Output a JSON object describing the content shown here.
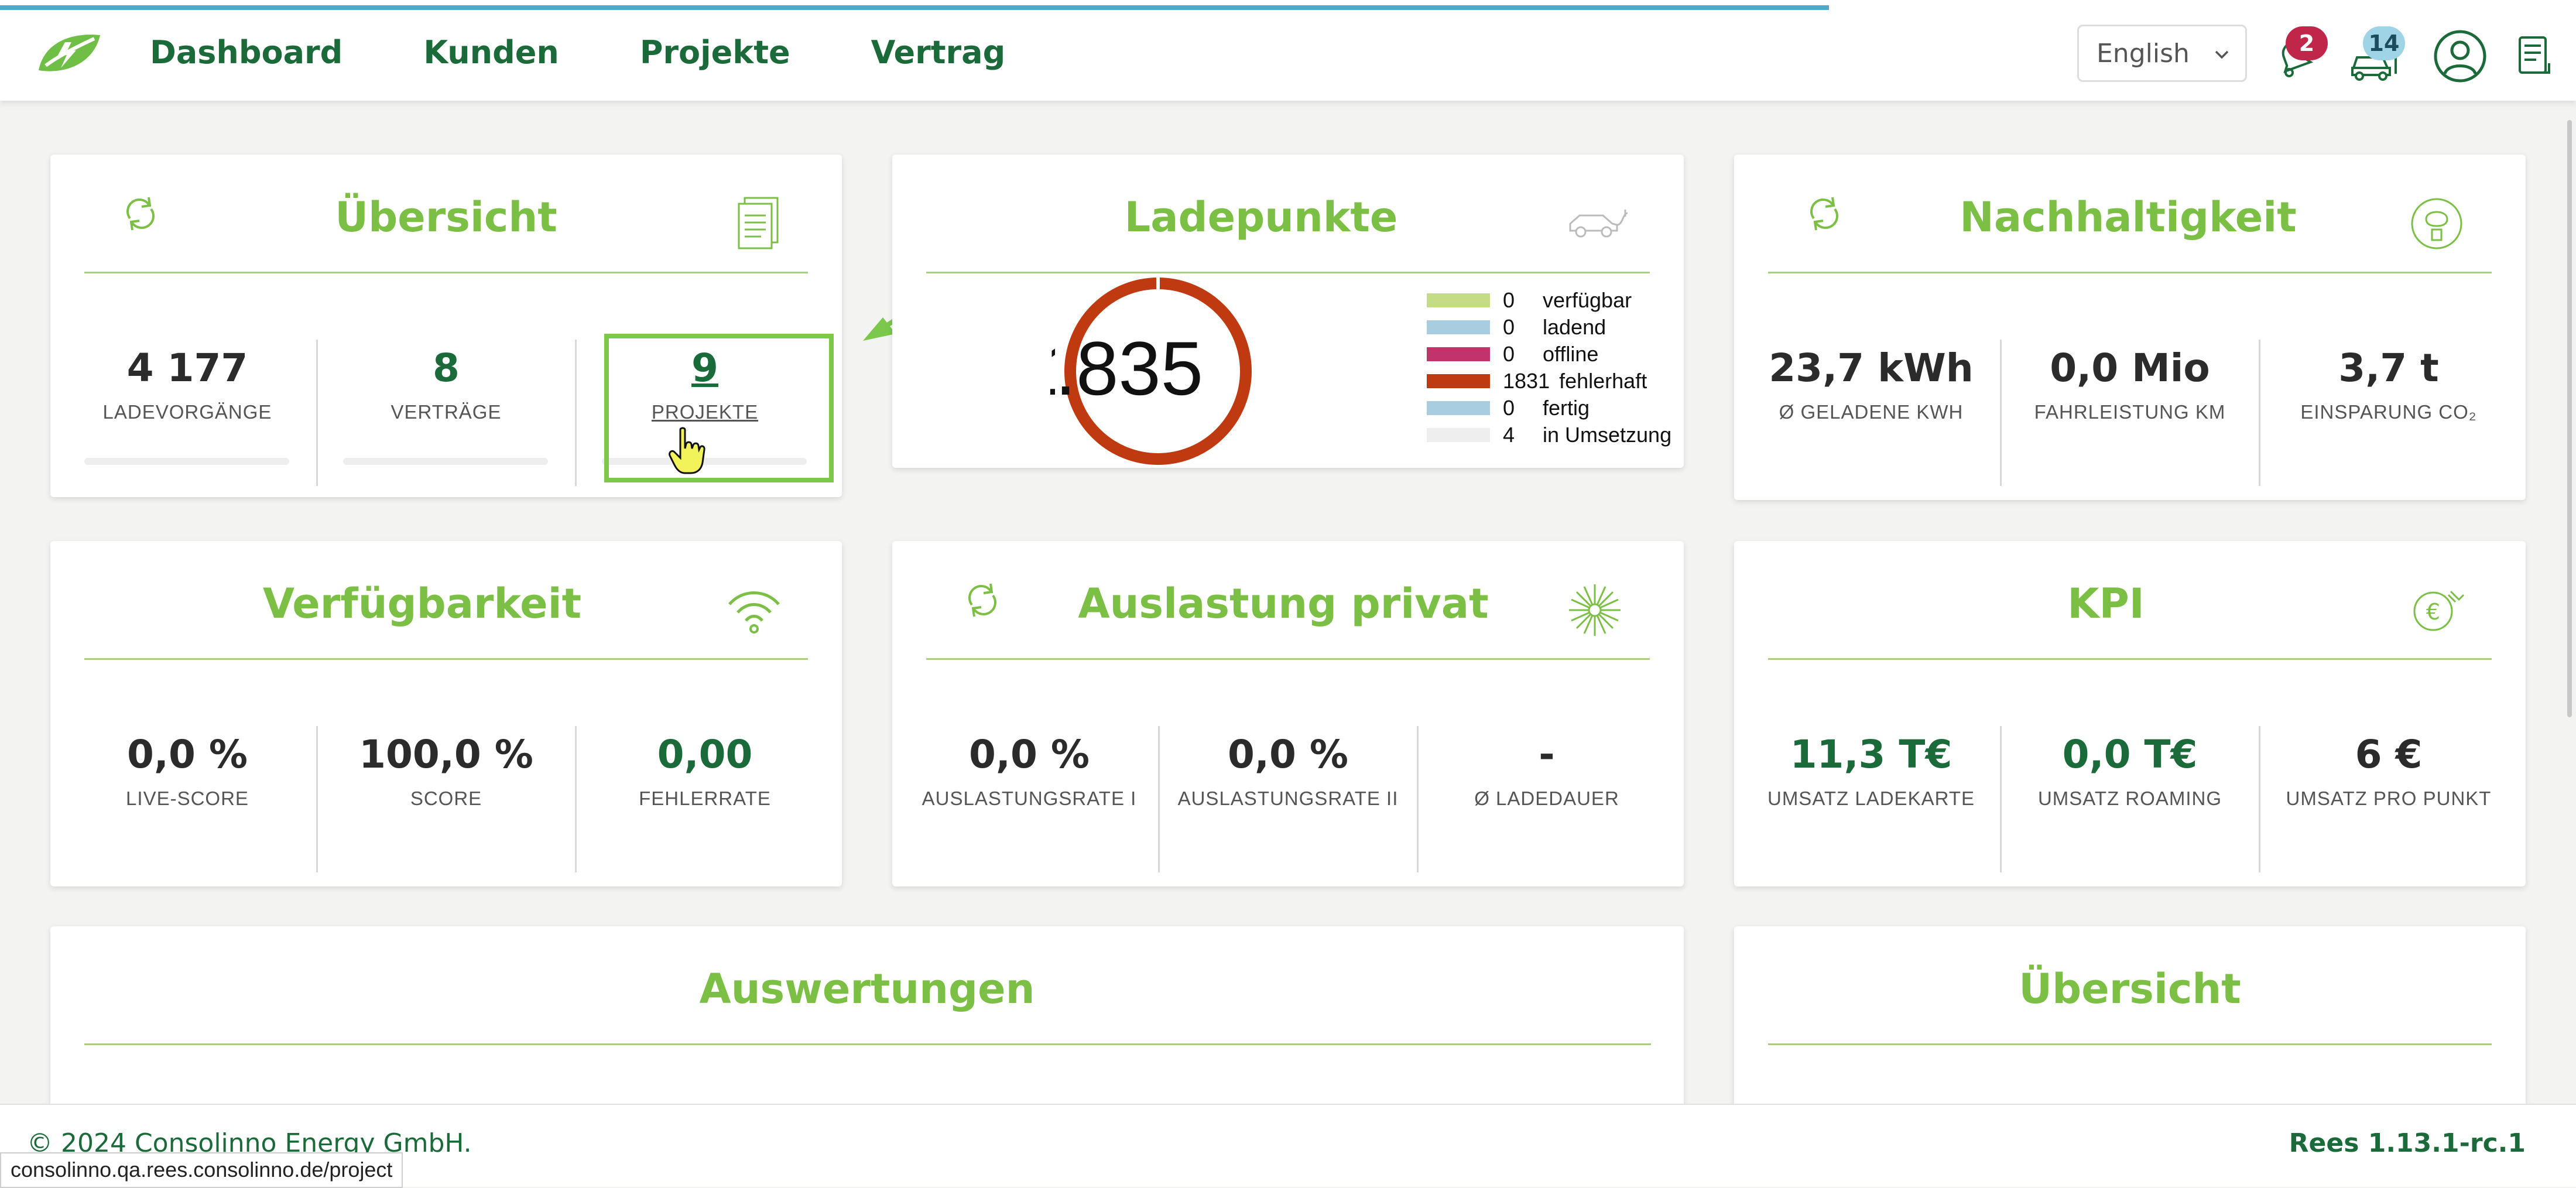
{
  "header": {
    "nav": [
      "Dashboard",
      "Kunden",
      "Projekte",
      "Vertrag"
    ],
    "language": "English",
    "notifications_count": "2",
    "charging_count": "14",
    "progress_fraction": 0.71
  },
  "cards": {
    "uebersicht": {
      "title": "Übersicht",
      "stats": [
        {
          "value": "4 177",
          "label": "LADEVORGÄNGE"
        },
        {
          "value": "8",
          "label": "VERTRÄGE"
        },
        {
          "value": "9",
          "label": "PROJEKTE"
        }
      ]
    },
    "ladepunkte": {
      "title": "Ladepunkte",
      "center_text": ".835",
      "center_text_clip": "1",
      "legend": [
        {
          "count": "0",
          "label": "verfügbar",
          "color": "#c5dc86"
        },
        {
          "count": "0",
          "label": "ladend",
          "color": "#a8cde0"
        },
        {
          "count": "0",
          "label": "offline",
          "color": "#c0336b"
        },
        {
          "count": "1831",
          "label": "fehlerhaft",
          "color": "#bf3a10"
        },
        {
          "count": "0",
          "label": "fertig",
          "color": "#a8cde0"
        },
        {
          "count": "4",
          "label": "in Umsetzung",
          "color": "#eeeeee"
        }
      ]
    },
    "nachhaltigkeit": {
      "title": "Nachhaltigkeit",
      "stats": [
        {
          "value": "23,7 kWh",
          "label": "Ø GELADENE KWH"
        },
        {
          "value": "0,0 Mio",
          "label": "FAHRLEISTUNG KM"
        },
        {
          "value": "3,7 t",
          "label": "EINSPARUNG CO₂"
        }
      ]
    },
    "verfuegbarkeit": {
      "title": "Verfügbarkeit",
      "stats": [
        {
          "value": "0,0 %",
          "label": "LIVE-SCORE"
        },
        {
          "value": "100,0 %",
          "label": "SCORE"
        },
        {
          "value": "0,00",
          "label": "FEHLERRATE"
        }
      ]
    },
    "auslastung": {
      "title": "Auslastung privat",
      "stats": [
        {
          "value": "0,0 %",
          "label": "AUSLASTUNGSRATE I"
        },
        {
          "value": "0,0 %",
          "label": "AUSLASTUNGSRATE II"
        },
        {
          "value": "-",
          "label": "Ø LADEDAUER"
        }
      ]
    },
    "kpi": {
      "title": "KPI",
      "stats": [
        {
          "value": "11,3 T€",
          "label": "UMSATZ LADEKARTE"
        },
        {
          "value": "0,0 T€",
          "label": "UMSATZ ROAMING"
        },
        {
          "value": "6 €",
          "label": "UMSATZ PRO PUNKT"
        }
      ]
    },
    "auswertungen": {
      "title": "Auswertungen"
    },
    "uebersicht2": {
      "title": "Übersicht"
    }
  },
  "footer": {
    "copyright": "© 2024 Consolinno Energy GmbH.",
    "version": "Rees 1.13.1-rc.1"
  },
  "status_url": "consolinno.qa.rees.consolinno.de/project",
  "colors": {
    "brand_green": "#1b6a3a",
    "title_green": "#7bbf45",
    "highlight_green": "#7bc84a",
    "notification_badge": "#c0264a",
    "charging_badge": "#9fd4e6",
    "donut": "#bf3a10"
  }
}
